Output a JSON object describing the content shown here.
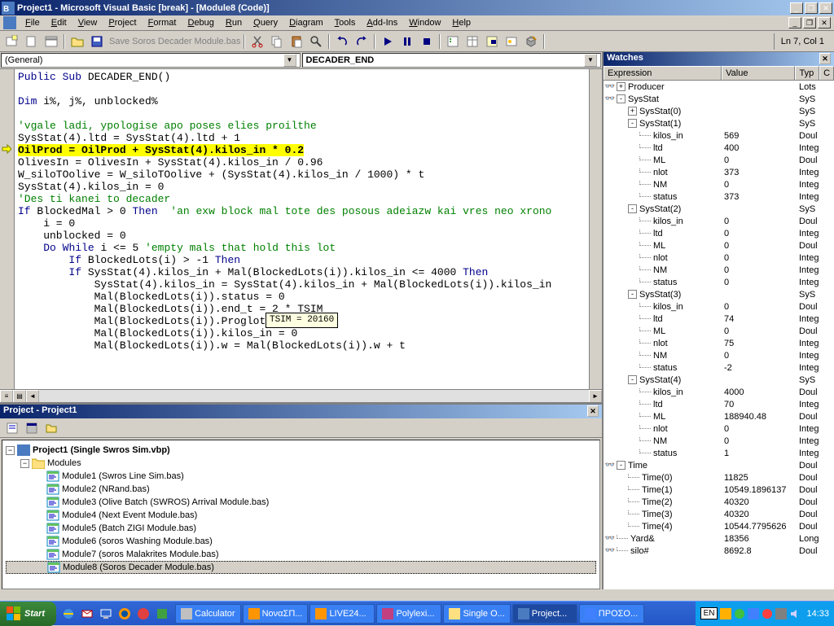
{
  "title": "Project1 - Microsoft Visual Basic [break] - [Module8 (Code)]",
  "menu": [
    "File",
    "Edit",
    "View",
    "Project",
    "Format",
    "Debug",
    "Run",
    "Query",
    "Diagram",
    "Tools",
    "Add-Ins",
    "Window",
    "Help"
  ],
  "toolbar_save": "Save Soros Decader Module.bas",
  "cursor_pos": "Ln 7, Col 1",
  "dd_left": "(General)",
  "dd_right": "DECADER_END",
  "tooltip": "TSIM = 20160",
  "watches": {
    "title": "Watches",
    "headers": [
      "Expression",
      "Value",
      "Typ",
      "C"
    ],
    "rows": [
      {
        "g": 1,
        "ind": 0,
        "t": "+",
        "exp": "Producer",
        "val": "",
        "typ": "Lots"
      },
      {
        "g": 1,
        "ind": 0,
        "t": "-",
        "exp": "SysStat",
        "val": "",
        "typ": "SyS"
      },
      {
        "g": 0,
        "ind": 1,
        "t": "+",
        "exp": "SysStat(0)",
        "val": "",
        "typ": "SyS"
      },
      {
        "g": 0,
        "ind": 1,
        "t": "-",
        "exp": "SysStat(1)",
        "val": "",
        "typ": "SyS"
      },
      {
        "g": 0,
        "ind": 2,
        "t": "",
        "exp": "kilos_in",
        "val": "569",
        "typ": "Doul"
      },
      {
        "g": 0,
        "ind": 2,
        "t": "",
        "exp": "ltd",
        "val": "400",
        "typ": "Integ"
      },
      {
        "g": 0,
        "ind": 2,
        "t": "",
        "exp": "ML",
        "val": "0",
        "typ": "Doul"
      },
      {
        "g": 0,
        "ind": 2,
        "t": "",
        "exp": "nlot",
        "val": "373",
        "typ": "Integ"
      },
      {
        "g": 0,
        "ind": 2,
        "t": "",
        "exp": "NM",
        "val": "0",
        "typ": "Integ"
      },
      {
        "g": 0,
        "ind": 2,
        "t": "",
        "exp": "status",
        "val": "373",
        "typ": "Integ"
      },
      {
        "g": 0,
        "ind": 1,
        "t": "-",
        "exp": "SysStat(2)",
        "val": "",
        "typ": "SyS"
      },
      {
        "g": 0,
        "ind": 2,
        "t": "",
        "exp": "kilos_in",
        "val": "0",
        "typ": "Doul"
      },
      {
        "g": 0,
        "ind": 2,
        "t": "",
        "exp": "ltd",
        "val": "0",
        "typ": "Integ"
      },
      {
        "g": 0,
        "ind": 2,
        "t": "",
        "exp": "ML",
        "val": "0",
        "typ": "Doul"
      },
      {
        "g": 0,
        "ind": 2,
        "t": "",
        "exp": "nlot",
        "val": "0",
        "typ": "Integ"
      },
      {
        "g": 0,
        "ind": 2,
        "t": "",
        "exp": "NM",
        "val": "0",
        "typ": "Integ"
      },
      {
        "g": 0,
        "ind": 2,
        "t": "",
        "exp": "status",
        "val": "0",
        "typ": "Integ"
      },
      {
        "g": 0,
        "ind": 1,
        "t": "-",
        "exp": "SysStat(3)",
        "val": "",
        "typ": "SyS"
      },
      {
        "g": 0,
        "ind": 2,
        "t": "",
        "exp": "kilos_in",
        "val": "0",
        "typ": "Doul"
      },
      {
        "g": 0,
        "ind": 2,
        "t": "",
        "exp": "ltd",
        "val": "74",
        "typ": "Integ"
      },
      {
        "g": 0,
        "ind": 2,
        "t": "",
        "exp": "ML",
        "val": "0",
        "typ": "Doul"
      },
      {
        "g": 0,
        "ind": 2,
        "t": "",
        "exp": "nlot",
        "val": "75",
        "typ": "Integ"
      },
      {
        "g": 0,
        "ind": 2,
        "t": "",
        "exp": "NM",
        "val": "0",
        "typ": "Integ"
      },
      {
        "g": 0,
        "ind": 2,
        "t": "",
        "exp": "status",
        "val": "-2",
        "typ": "Integ"
      },
      {
        "g": 0,
        "ind": 1,
        "t": "-",
        "exp": "SysStat(4)",
        "val": "",
        "typ": "SyS"
      },
      {
        "g": 0,
        "ind": 2,
        "t": "",
        "exp": "kilos_in",
        "val": "4000",
        "typ": "Doul"
      },
      {
        "g": 0,
        "ind": 2,
        "t": "",
        "exp": "ltd",
        "val": "70",
        "typ": "Integ"
      },
      {
        "g": 0,
        "ind": 2,
        "t": "",
        "exp": "ML",
        "val": "188940.48",
        "typ": "Doul"
      },
      {
        "g": 0,
        "ind": 2,
        "t": "",
        "exp": "nlot",
        "val": "0",
        "typ": "Integ"
      },
      {
        "g": 0,
        "ind": 2,
        "t": "",
        "exp": "NM",
        "val": "0",
        "typ": "Integ"
      },
      {
        "g": 0,
        "ind": 2,
        "t": "",
        "exp": "status",
        "val": "1",
        "typ": "Integ"
      },
      {
        "g": 1,
        "ind": 0,
        "t": "-",
        "exp": "Time",
        "val": "",
        "typ": "Doul"
      },
      {
        "g": 0,
        "ind": 1,
        "t": "",
        "exp": "Time(0)",
        "val": "11825",
        "typ": "Doul"
      },
      {
        "g": 0,
        "ind": 1,
        "t": "",
        "exp": "Time(1)",
        "val": "10549.1896137",
        "typ": "Doul"
      },
      {
        "g": 0,
        "ind": 1,
        "t": "",
        "exp": "Time(2)",
        "val": "40320",
        "typ": "Doul"
      },
      {
        "g": 0,
        "ind": 1,
        "t": "",
        "exp": "Time(3)",
        "val": "40320",
        "typ": "Doul"
      },
      {
        "g": 0,
        "ind": 1,
        "t": "",
        "exp": "Time(4)",
        "val": "10544.7795626",
        "typ": "Doul"
      },
      {
        "g": 1,
        "ind": 0,
        "t": "",
        "exp": "Yard&",
        "val": "18356",
        "typ": "Long"
      },
      {
        "g": 1,
        "ind": 0,
        "t": "",
        "exp": "silo#",
        "val": "8692.8",
        "typ": "Doul"
      }
    ]
  },
  "project": {
    "title": "Project - Project1",
    "root": "Project1 (Single Swros Sim.vbp)",
    "folder": "Modules",
    "items": [
      "Module1 (Swros Line Sim.bas)",
      "Module2 (NRand.bas)",
      "Module3 (Olive Batch (SWROS) Arrival Module.bas)",
      "Module4 (Next Event Module.bas)",
      "Module5 (Batch ZIGI Module.bas)",
      "Module6 (soros Washing Module.bas)",
      "Module7 (soros Malakrites Module.bas)",
      "Module8 (Soros Decader Module.bas)"
    ]
  },
  "taskbar": {
    "start": "Start",
    "tasks": [
      "Calculator",
      "ΝοναΣΠ...",
      "LIVE24...",
      "Polylexi...",
      "Single O...",
      "Project...",
      "ΠΡΟΣΟ..."
    ],
    "clock": "14:33",
    "lang": "EN"
  }
}
